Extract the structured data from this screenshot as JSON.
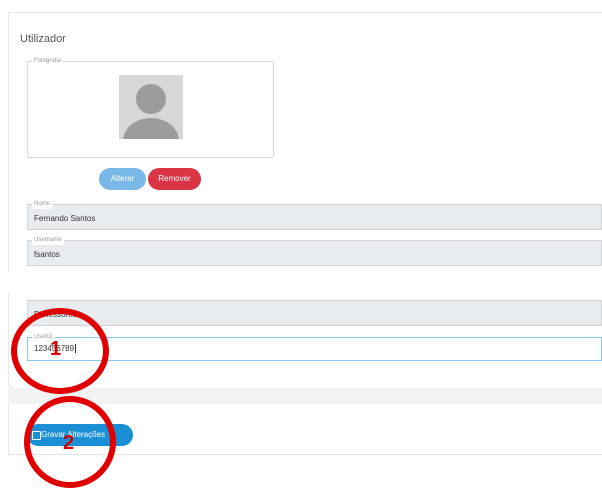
{
  "section_title": "Utilizador",
  "photo": {
    "legend": "Fotografia",
    "alterar_label": "Alterar",
    "remover_label": "Remover"
  },
  "fields": {
    "nome": {
      "legend": "Nome",
      "value": "Fernando Santos"
    },
    "username": {
      "legend": "Username",
      "value": "fsantos"
    },
    "group": {
      "value": "Professores"
    },
    "userid": {
      "legend": "UserID",
      "value": "123456789"
    }
  },
  "save_button_label": "Gravar Alterações",
  "annotations": [
    "1",
    "2"
  ],
  "colors": {
    "primary": "#1a8fd6",
    "danger": "#d93545",
    "light_primary": "#7ab8e8",
    "annotation": "#e00000"
  },
  "icons": [
    "avatar-placeholder",
    "save-icon"
  ]
}
